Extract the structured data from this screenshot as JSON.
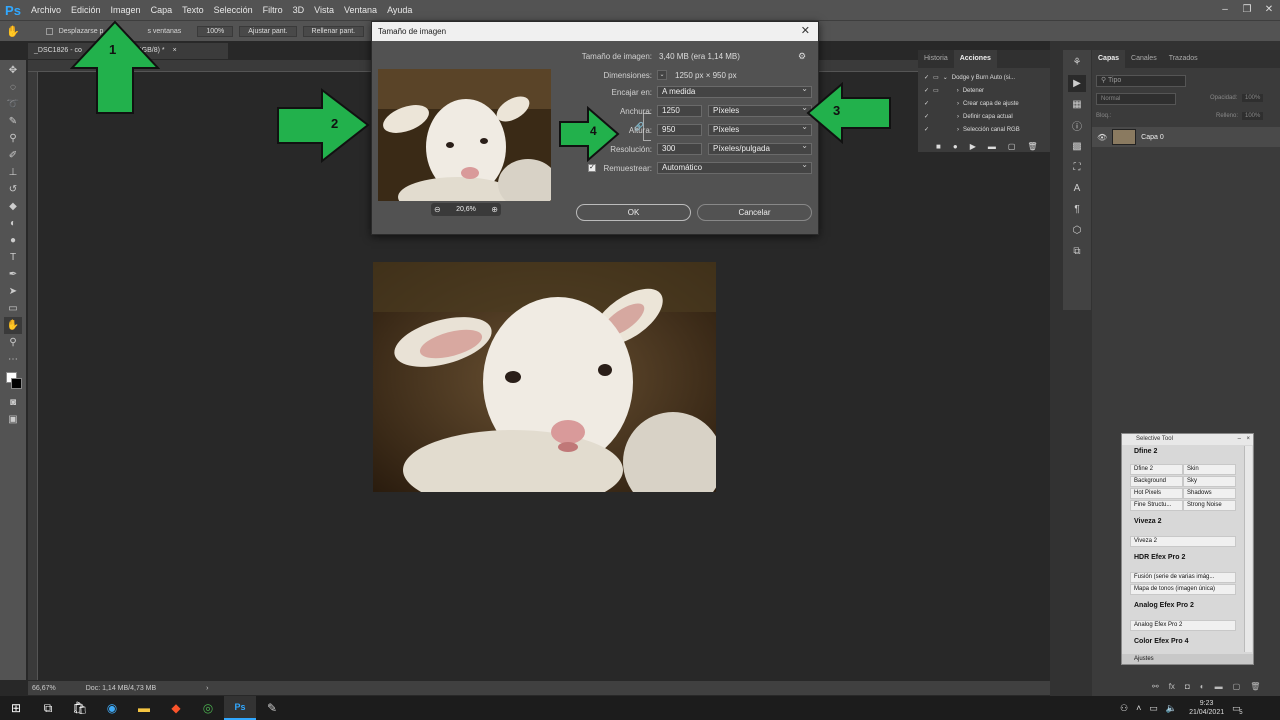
{
  "app": {
    "logo": "Ps"
  },
  "menu": [
    "Archivo",
    "Edición",
    "Imagen",
    "Capa",
    "Texto",
    "Selección",
    "Filtro",
    "3D",
    "Vista",
    "Ventana",
    "Ayuda"
  ],
  "options": {
    "scroll_label": "Desplazarse p",
    "windows_label": "s ventanas",
    "zoom_btn": "100%",
    "fit_btn": "Ajustar pant.",
    "fill_btn": "Rellenar pant."
  },
  "document": {
    "tab_label": "_DSC1826 - co",
    "tab_suffix": "(Capa 0, RGB/8) *",
    "zoom": "66,67%",
    "doc_size": "Doc: 1,14 MB/4,73 MB"
  },
  "dialog": {
    "title": "Tamaño de imagen",
    "preview_zoom": "20,6%",
    "size_label": "Tamaño de imagen:",
    "size_value": "3,40 MB (era 1,14 MB)",
    "dims_label": "Dimensiones:",
    "dims_value": "1250 px × 950 px",
    "fit_label": "Encajar en:",
    "fit_value": "A medida",
    "width_label": "Anchura:",
    "width_value": "1250",
    "width_unit": "Píxeles",
    "height_label": "Altura:",
    "height_value": "950",
    "height_unit": "Píxeles",
    "res_label": "Resolución:",
    "res_value": "300",
    "res_unit": "Píxeles/pulgada",
    "resample_label": "Remuestrear:",
    "resample_value": "Automático",
    "ok": "OK",
    "cancel": "Cancelar"
  },
  "annotations": [
    "1",
    "2",
    "3",
    "4"
  ],
  "history_panel": {
    "tabs": [
      "Historia",
      "Acciones"
    ],
    "actions": [
      "Dodge y Burn Auto (si...",
      "Detener",
      "Crear capa de ajuste",
      "Definir capa actual",
      "Selección canal RGB"
    ]
  },
  "layers_panel": {
    "tabs": [
      "Capas",
      "Canales",
      "Trazados"
    ],
    "search_placeholder": "Tipo",
    "blend": "Normal",
    "opacity_label": "Opacidad:",
    "opacity_value": "100%",
    "lock_label": "Bloq.:",
    "fill_label": "Relleno:",
    "fill_value": "100%",
    "layer_name": "Capa 0"
  },
  "selective_tool": {
    "title": "Selective Tool",
    "dfine": {
      "title": "Dfine 2",
      "items": [
        "Dfine 2",
        "Skin",
        "Background",
        "Sky",
        "Hot Pixels",
        "Shadows",
        "Fine Structu...",
        "Strong Noise"
      ]
    },
    "viveza": {
      "title": "Viveza 2",
      "items": [
        "Viveza 2"
      ]
    },
    "hdr": {
      "title": "HDR Efex Pro 2",
      "items": [
        "Fusión (serie de varias imág...",
        "Mapa de tonos (imagen única)"
      ]
    },
    "analog": {
      "title": "Analog Efex Pro 2",
      "items": [
        "Analog Efex Pro 2"
      ]
    },
    "color": {
      "title": "Color Efex Pro 4"
    },
    "footer": "Ajustes"
  },
  "taskbar": {
    "time": "9:23",
    "date": "21/04/2021",
    "notif_count": "5"
  },
  "colors": {
    "accent_green": "#22b14c",
    "ps_blue": "#31a8ff"
  }
}
